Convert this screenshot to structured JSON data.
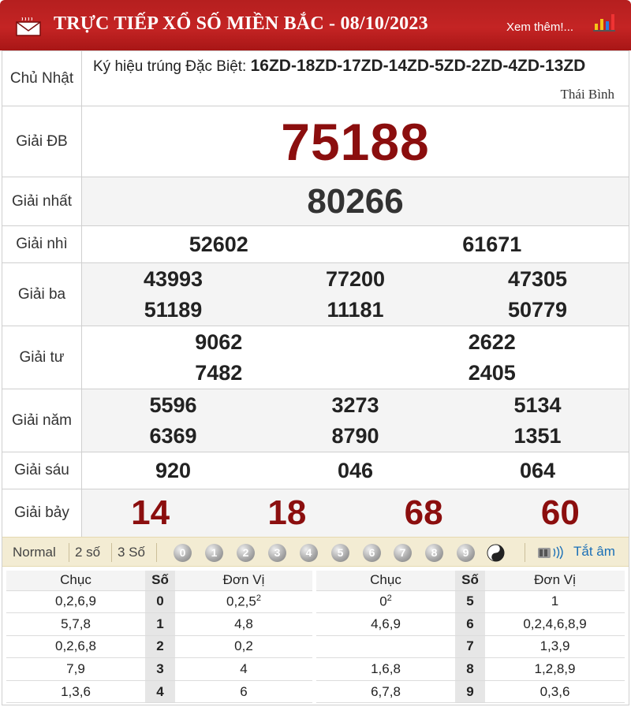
{
  "header": {
    "title": "TRỰC TIẾP XỔ SỐ MIỀN BẮC - 08/10/2023",
    "more": "Xem thêm!..."
  },
  "info": {
    "day": "Chủ Nhật",
    "special_label": "Ký hiệu trúng Đặc Biệt:",
    "special_codes": "16ZD-18ZD-17ZD-14ZD-5ZD-2ZD-4ZD-13ZD",
    "province": "Thái Bình"
  },
  "prizes": [
    {
      "label": "Giải ĐB",
      "numbers": [
        "75188"
      ]
    },
    {
      "label": "Giải nhất",
      "numbers": [
        "80266"
      ]
    },
    {
      "label": "Giải nhì",
      "numbers": [
        "52602",
        "61671"
      ]
    },
    {
      "label": "Giải ba",
      "numbers": [
        "43993",
        "77200",
        "47305",
        "51189",
        "11181",
        "50779"
      ]
    },
    {
      "label": "Giải tư",
      "numbers": [
        "9062",
        "2622",
        "7482",
        "2405"
      ]
    },
    {
      "label": "Giải năm",
      "numbers": [
        "5596",
        "3273",
        "5134",
        "6369",
        "8790",
        "1351"
      ]
    },
    {
      "label": "Giải sáu",
      "numbers": [
        "920",
        "046",
        "064"
      ]
    },
    {
      "label": "Giải bảy",
      "numbers": [
        "14",
        "18",
        "68",
        "60"
      ]
    }
  ],
  "controls": {
    "options": [
      "Normal",
      "2 số",
      "3 Số"
    ],
    "digits": [
      "0",
      "1",
      "2",
      "3",
      "4",
      "5",
      "6",
      "7",
      "8",
      "9"
    ],
    "mute": "Tắt âm"
  },
  "loto": {
    "headers": {
      "chuc": "Chục",
      "so": "Số",
      "don_vi": "Đơn Vị"
    },
    "left": [
      {
        "chuc": "0,2,6,9",
        "so": "0",
        "don_vi": "0,2,5",
        "don_vi_sup": "2"
      },
      {
        "chuc": "5,7,8",
        "so": "1",
        "don_vi": "4,8"
      },
      {
        "chuc": "0,2,6,8",
        "so": "2",
        "don_vi": "0,2"
      },
      {
        "chuc": "7,9",
        "so": "3",
        "don_vi": "4"
      },
      {
        "chuc": "1,3,6",
        "so": "4",
        "don_vi": "6"
      }
    ],
    "right": [
      {
        "chuc": "0",
        "chuc_sup": "2",
        "so": "5",
        "don_vi": "1"
      },
      {
        "chuc": "4,6,9",
        "so": "6",
        "don_vi": "0,2,4,6,8,9"
      },
      {
        "chuc": "",
        "so": "7",
        "don_vi": "1,3,9"
      },
      {
        "chuc": "1,6,8",
        "so": "8",
        "don_vi": "1,2,8,9"
      },
      {
        "chuc": "6,7,8",
        "so": "9",
        "don_vi": "0,3,6"
      }
    ]
  },
  "colors": {
    "header": "#c42424",
    "special": "#8b0e0e",
    "control_bar": "#f3ecd3",
    "link": "#1a6fb7"
  }
}
